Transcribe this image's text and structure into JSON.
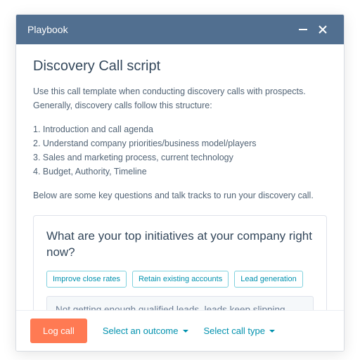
{
  "window": {
    "title": "Playbook"
  },
  "page": {
    "heading": "Discovery Call script",
    "intro": "Use this call template when conducting discovery calls with prospects. Generally, discovery calls follow this structure:",
    "steps": [
      "1. Introduction and call agenda",
      "2. Understand company priorities/business model/players",
      "3. Sales and marketing process, current technology",
      "4. Budget, Authority, Timeline"
    ],
    "below_note": "Below are some key questions and talk tracks to run your discovery call."
  },
  "question_card": {
    "prompt": "What are your top initiatives at your company right now?",
    "chips": [
      "Improve close rates",
      "Retain existing accounts",
      "Lead generation"
    ],
    "textarea_value": "Not getting enough qualified leads, leads keep slipping through the cracks"
  },
  "footer": {
    "primary": "Log call",
    "outcome_label": "Select an outcome",
    "calltype_label": "Select call type"
  }
}
